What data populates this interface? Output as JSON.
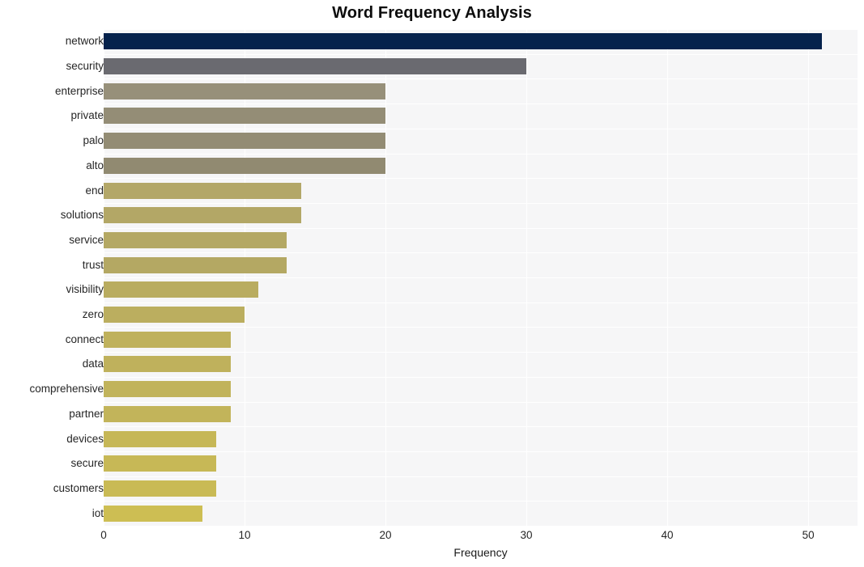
{
  "chart_data": {
    "type": "bar",
    "orientation": "horizontal",
    "title": "Word Frequency Analysis",
    "xlabel": "Frequency",
    "ylabel": "",
    "xlim": [
      0,
      53.5
    ],
    "ylim": [
      0,
      20
    ],
    "grid": true,
    "legend": false,
    "legend_position": "none",
    "xticks": [
      0,
      10,
      20,
      30,
      40,
      50
    ],
    "xtick_labels": [
      "0",
      "10",
      "20",
      "30",
      "40",
      "50"
    ],
    "categories": [
      "network",
      "security",
      "enterprise",
      "private",
      "palo",
      "alto",
      "end",
      "solutions",
      "service",
      "trust",
      "visibility",
      "zero",
      "connect",
      "data",
      "comprehensive",
      "partner",
      "devices",
      "secure",
      "customers",
      "iot"
    ],
    "values": [
      51,
      30,
      20,
      20,
      20,
      20,
      14,
      14,
      13,
      13,
      11,
      10,
      9,
      9,
      9,
      9,
      8,
      8,
      8,
      7
    ],
    "bar_colors": [
      "#05224c",
      "#6a6a70",
      "#97907a",
      "#948d76",
      "#938c74",
      "#918a71",
      "#b3a768",
      "#b3a766",
      "#b4a864",
      "#b4a863",
      "#b9ac60",
      "#bbae5f",
      "#bfb15c",
      "#bfb15c",
      "#c1b35b",
      "#c2b45a",
      "#c6b757",
      "#c7b856",
      "#c9ba55",
      "#cdbe53"
    ],
    "plot_background": "#f6f6f7",
    "grid_color": "#ffffff",
    "figure_background": "#ffffff",
    "text_color": "#262626"
  }
}
